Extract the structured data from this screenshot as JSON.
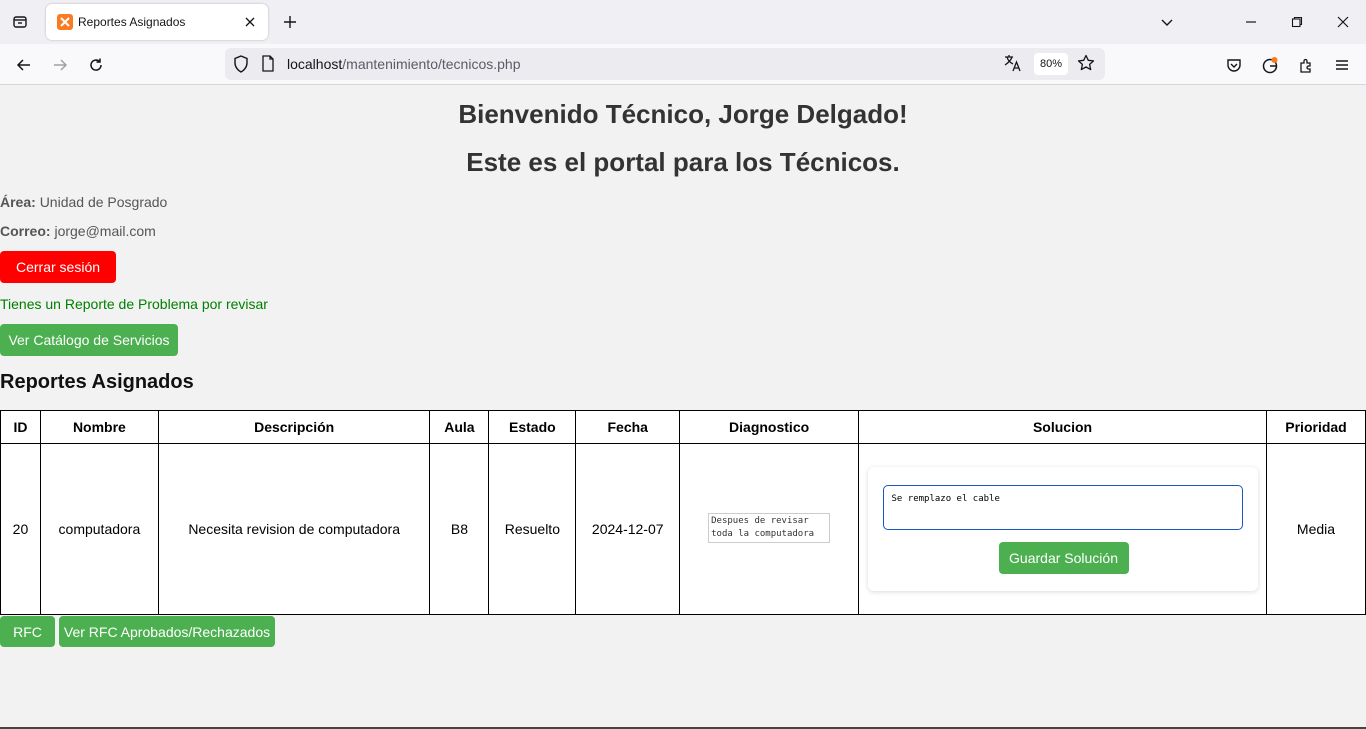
{
  "browser": {
    "tab_title": "Reportes Asignados",
    "url_host": "localhost",
    "url_path": "/mantenimiento/tecnicos.php",
    "zoom": "80%"
  },
  "page": {
    "welcome": "Bienvenido Técnico, Jorge Delgado!",
    "subtitle": "Este es el portal para los Técnicos.",
    "area_label": "Área:",
    "area_value": "Unidad de Posgrado",
    "email_label": "Correo:",
    "email_value": "jorge@mail.com",
    "logout_label": "Cerrar sesión",
    "notice": "Tienes un Reporte de Problema por revisar",
    "catalog_label": "Ver Catálogo de Servicios",
    "section_title": "Reportes Asignados",
    "rfc_label": "RFC",
    "rfc_list_label": "Ver RFC Aprobados/Rechazados"
  },
  "table": {
    "headers": [
      "ID",
      "Nombre",
      "Descripción",
      "Aula",
      "Estado",
      "Fecha",
      "Diagnostico",
      "Solucion",
      "Prioridad"
    ],
    "row": {
      "id": "20",
      "nombre": "computadora",
      "descripcion": "Necesita revision de computadora",
      "aula": "B8",
      "estado": "Resuelto",
      "fecha": "2024-12-07",
      "diagnostico": "Despues de revisar toda la computadora el cable",
      "solucion": "Se remplazo el cable",
      "guardar_label": "Guardar Solución",
      "prioridad": "Media"
    }
  },
  "colors": {
    "green": "#4caf50",
    "red": "#ff0000",
    "notice_green": "#008000"
  }
}
